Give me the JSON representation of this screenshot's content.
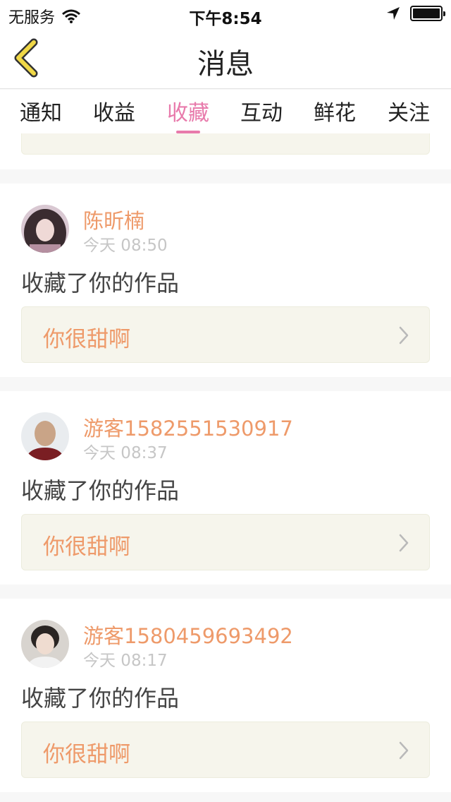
{
  "status_bar": {
    "carrier": "无服务",
    "time": "下午8:54",
    "icons": [
      "wifi-icon",
      "location-arrow-icon",
      "battery-icon"
    ]
  },
  "nav": {
    "title": "消息",
    "back_icon": "chevron-left-icon",
    "accent": "#f0d847"
  },
  "tabs": [
    {
      "label": "通知",
      "active": false
    },
    {
      "label": "收益",
      "active": false
    },
    {
      "label": "收藏",
      "active": true
    },
    {
      "label": "互动",
      "active": false
    },
    {
      "label": "鲜花",
      "active": false
    },
    {
      "label": "关注",
      "active": false
    }
  ],
  "colors": {
    "active_tab": "#e87aab",
    "username": "#ee9a6a",
    "timestamp": "#c6c6c6",
    "link_bg": "#f6f5ec"
  },
  "messages": [
    {
      "user": "陈昕楠",
      "time": "今天 08:50",
      "action": "收藏了你的作品",
      "work_title": "你很甜啊"
    },
    {
      "user": "游客1582551530917",
      "time": "今天 08:37",
      "action": "收藏了你的作品",
      "work_title": "你很甜啊"
    },
    {
      "user": "游客1580459693492",
      "time": "今天 08:17",
      "action": "收藏了你的作品",
      "work_title": "你很甜啊"
    }
  ]
}
